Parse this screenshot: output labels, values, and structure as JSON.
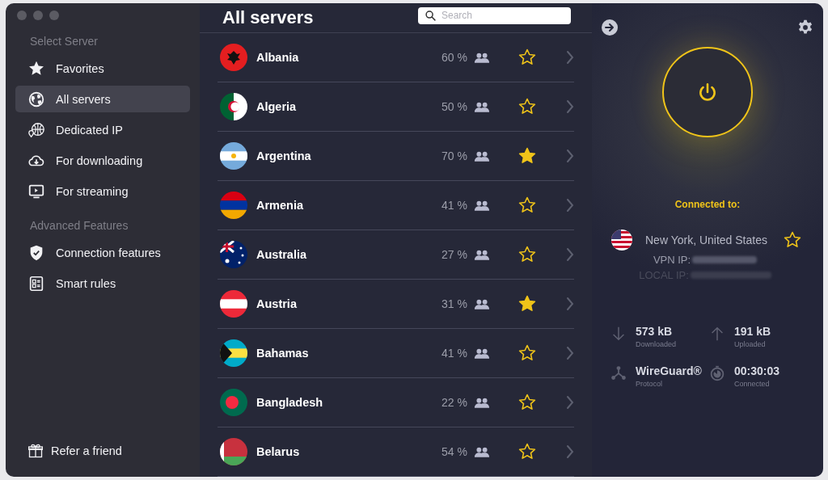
{
  "sidebar": {
    "sections": [
      {
        "title": "Select Server",
        "items": [
          {
            "label": "Favorites",
            "selected": false
          },
          {
            "label": "All servers",
            "selected": true
          },
          {
            "label": "Dedicated IP",
            "selected": false
          },
          {
            "label": "For downloading",
            "selected": false
          },
          {
            "label": "For streaming",
            "selected": false
          }
        ]
      },
      {
        "title": "Advanced Features",
        "items": [
          {
            "label": "Connection features",
            "selected": false
          },
          {
            "label": "Smart rules",
            "selected": false
          }
        ]
      }
    ],
    "footer": {
      "label": "Refer a friend"
    }
  },
  "list": {
    "title": "All servers",
    "search": {
      "placeholder": "Search"
    },
    "rows": [
      {
        "name": "Albania",
        "load": "60 %",
        "favorite": false
      },
      {
        "name": "Algeria",
        "load": "50 %",
        "favorite": false
      },
      {
        "name": "Argentina",
        "load": "70 %",
        "favorite": true
      },
      {
        "name": "Armenia",
        "load": "41 %",
        "favorite": false
      },
      {
        "name": "Australia",
        "load": "27 %",
        "favorite": false
      },
      {
        "name": "Austria",
        "load": "31 %",
        "favorite": true
      },
      {
        "name": "Bahamas",
        "load": "41 %",
        "favorite": false
      },
      {
        "name": "Bangladesh",
        "load": "22 %",
        "favorite": false
      },
      {
        "name": "Belarus",
        "load": "54 %",
        "favorite": false
      }
    ]
  },
  "status": {
    "connected": true,
    "heading": "Connected to:",
    "location": "New York, United States",
    "favorite": false,
    "vpn_ip_label": "VPN IP:",
    "local_ip_label": "LOCAL IP:",
    "stats": [
      {
        "value": "573 kB",
        "caption": "Downloaded"
      },
      {
        "value": "191 kB",
        "caption": "Uploaded"
      },
      {
        "value": "WireGuard®",
        "caption": "Protocol"
      },
      {
        "value": "00:30:03",
        "caption": "Connected"
      }
    ]
  }
}
